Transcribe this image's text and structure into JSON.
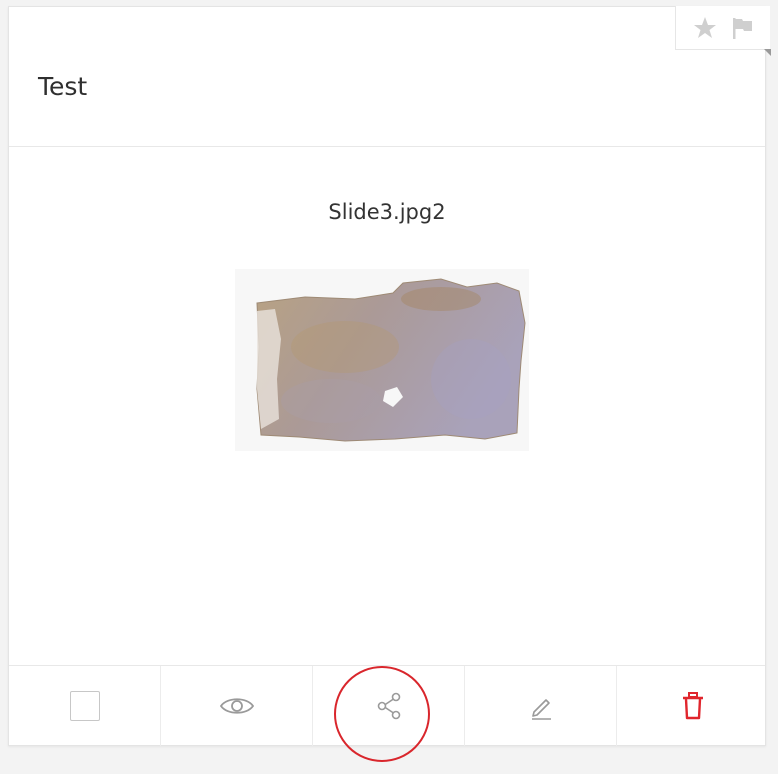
{
  "card": {
    "title": "Test",
    "file_name": "Slide3.jpg2"
  },
  "corner_icons": [
    "star-icon",
    "flag-icon"
  ],
  "actions": [
    {
      "name": "select-checkbox",
      "icon": "checkbox-icon"
    },
    {
      "name": "view-button",
      "icon": "eye-icon"
    },
    {
      "name": "share-button",
      "icon": "share-icon"
    },
    {
      "name": "edit-button",
      "icon": "pencil-icon"
    },
    {
      "name": "delete-button",
      "icon": "trash-icon"
    }
  ],
  "colors": {
    "icon_gray": "#9a9a9a",
    "delete_red": "#e0262d",
    "highlight_red": "#d9262c",
    "tissue_brown": "#b19a80",
    "tissue_purple": "#a79fb8"
  }
}
